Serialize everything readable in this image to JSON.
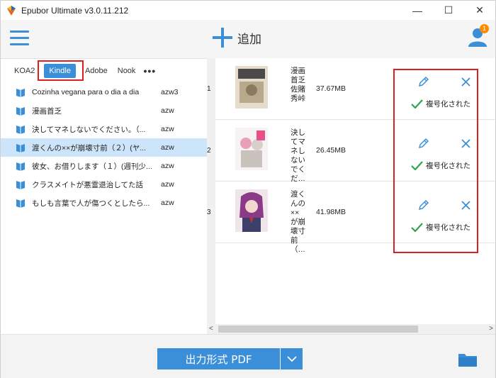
{
  "window": {
    "title": "Epubor Ultimate v3.0.11.212",
    "minimize_label": "—",
    "maximize_label": "☐",
    "close_label": "✕"
  },
  "toolbar": {
    "add_label": "追加",
    "notification_count": "1"
  },
  "tabs": {
    "items": [
      "KOA2",
      "Kindle",
      "Adobe",
      "Nook"
    ],
    "more_label": "•••",
    "active": "Kindle"
  },
  "books": [
    {
      "name": "Cozinha vegana para o dia a dia",
      "format": "azw3"
    },
    {
      "name": "漫画首乏",
      "format": "azw"
    },
    {
      "name": "決してマネしないでください。（...",
      "format": "azw"
    },
    {
      "name": "渡くんの××が崩壊寸前（２）(ヤ...",
      "format": "azw"
    },
    {
      "name": "彼女、お借りします（１）(週刊少...",
      "format": "azw"
    },
    {
      "name": "クラスメイトが悪霊退治してた話",
      "format": "azw"
    },
    {
      "name": "もしも言葉で人が傷つくとしたら...",
      "format": "azw"
    }
  ],
  "selected_book_index": 3,
  "rows": [
    {
      "num": "1",
      "title": "漫画首乏佐賭秀峠",
      "size": "37.67MB",
      "status": "複号化された"
    },
    {
      "num": "2",
      "title": "決してマネしないでくだ…",
      "size": "26.45MB",
      "status": "複号化された"
    },
    {
      "num": "3",
      "title": "渡くんの××が崩壊寸前（…",
      "size": "41.98MB",
      "status": "複号化された"
    }
  ],
  "scroll": {
    "left_arrow": "<",
    "right_arrow": ">"
  },
  "bottom": {
    "output_label": "出力形式 PDF"
  },
  "colors": {
    "accent": "#3b8fd9",
    "highlight": "#e02020",
    "check": "#2da44e",
    "badge": "#ff8a00"
  }
}
